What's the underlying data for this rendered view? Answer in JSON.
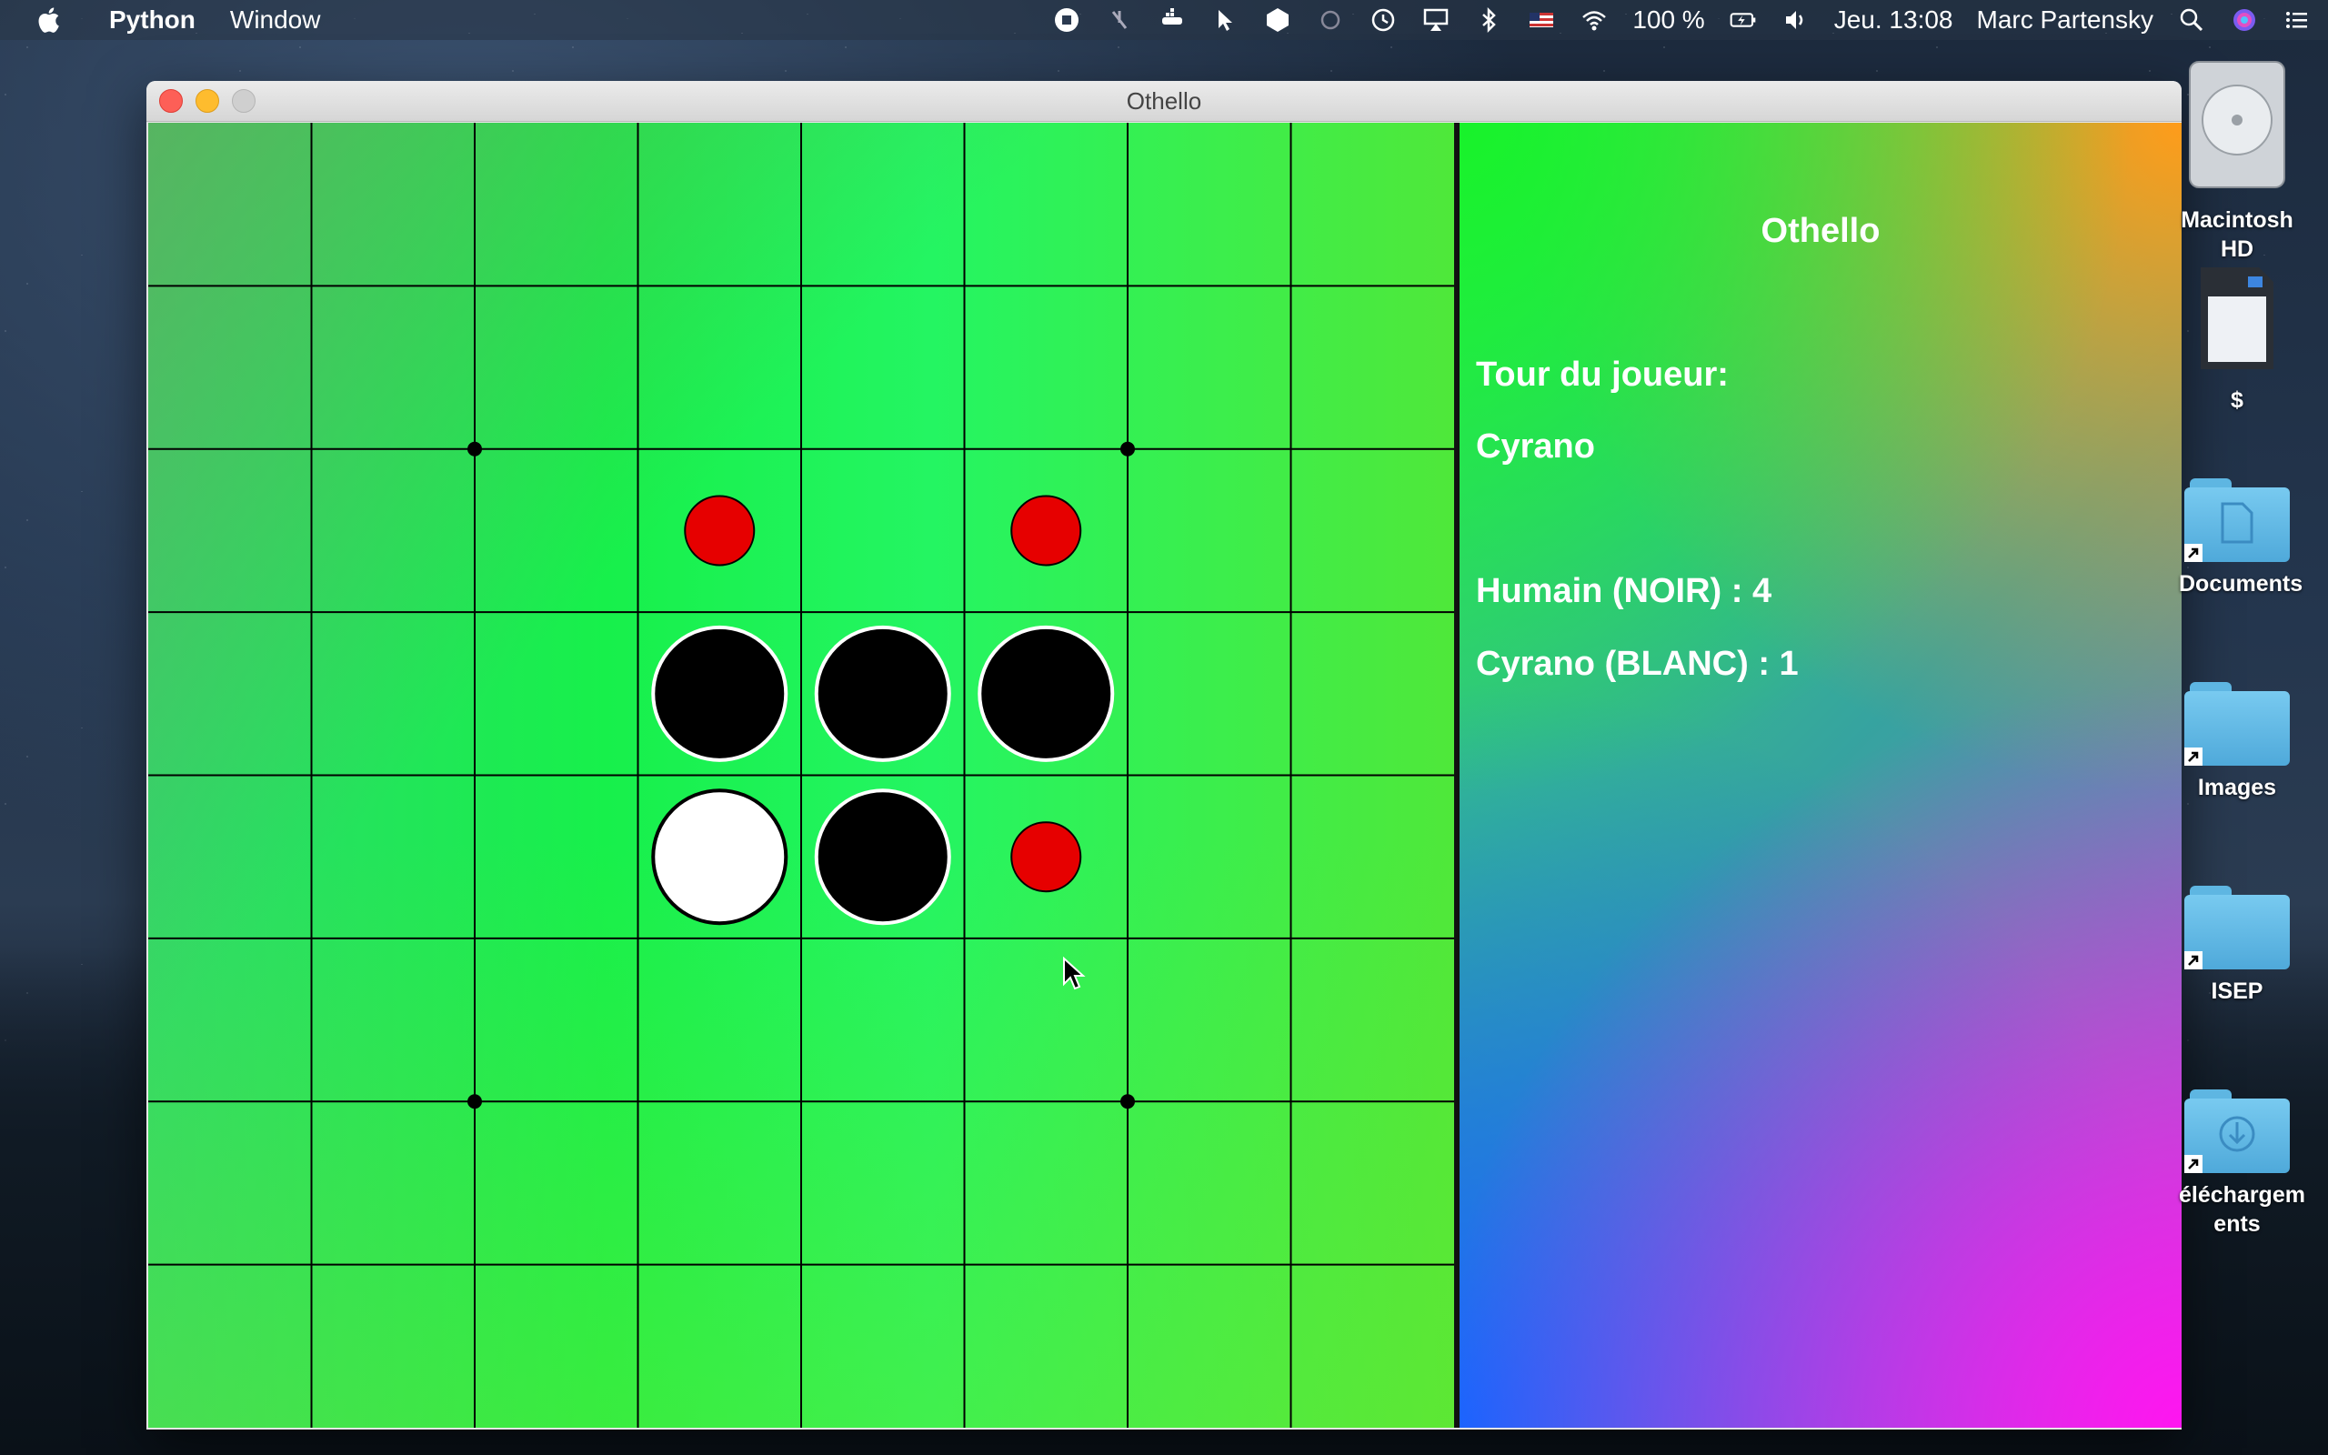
{
  "menubar": {
    "apple_icon": "apple-logo-icon",
    "app_name": "Python",
    "menus": [
      "Window"
    ],
    "status": {
      "battery": "100 %",
      "clock": "Jeu. 13:08",
      "user": "Marc Partensky"
    }
  },
  "window": {
    "title": "Othello",
    "board": {
      "rows": 8,
      "cols": 8,
      "pieces": [
        {
          "row": 3,
          "col": 3,
          "color": "black"
        },
        {
          "row": 3,
          "col": 4,
          "color": "black"
        },
        {
          "row": 3,
          "col": 5,
          "color": "black"
        },
        {
          "row": 4,
          "col": 3,
          "color": "white"
        },
        {
          "row": 4,
          "col": 4,
          "color": "black"
        }
      ],
      "hints": [
        {
          "row": 2,
          "col": 3
        },
        {
          "row": 2,
          "col": 5
        },
        {
          "row": 4,
          "col": 5
        }
      ],
      "star_points": [
        [
          2,
          2
        ],
        [
          2,
          6
        ],
        [
          6,
          2
        ],
        [
          6,
          6
        ]
      ]
    },
    "panel": {
      "title": "Othello",
      "turn_label": "Tour du joueur:",
      "current_player": "Cyrano",
      "score_black": "Humain (NOIR) : 4",
      "score_white": "Cyrano (BLANC) : 1"
    }
  },
  "desktop": {
    "icons": [
      {
        "label": "Macintosh HD",
        "icon": "hard-drive-icon"
      },
      {
        "label": "$",
        "icon": "sd-card-icon"
      },
      {
        "label": "Documents",
        "icon": "folder-icon"
      },
      {
        "label": "Images",
        "icon": "folder-icon"
      },
      {
        "label": "ISEP",
        "icon": "folder-icon"
      },
      {
        "label": "éléchargem ents",
        "icon": "downloads-folder-icon"
      }
    ]
  },
  "colors": {
    "hint": "#e60000",
    "black_piece": "#000000",
    "white_piece": "#ffffff",
    "grid": "#000000"
  }
}
